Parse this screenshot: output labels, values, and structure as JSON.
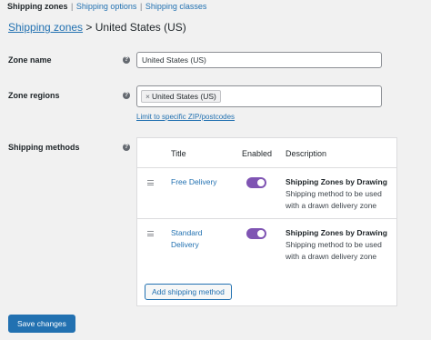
{
  "subnav": {
    "items": [
      {
        "label": "Shipping zones"
      },
      {
        "label": "Shipping options"
      },
      {
        "label": "Shipping classes"
      }
    ],
    "separator": "|"
  },
  "breadcrumb": {
    "link": "Shipping zones",
    "arrow": ">",
    "current": "United States (US)"
  },
  "form": {
    "zone_name": {
      "label": "Zone name",
      "value": "United States (US)"
    },
    "zone_regions": {
      "label": "Zone regions",
      "token_remove": "×",
      "token": "United States (US)",
      "limit_link": "Limit to specific ZIP/postcodes"
    },
    "help_glyph": "?"
  },
  "shipping_methods": {
    "label": "Shipping methods",
    "columns": {
      "title": "Title",
      "enabled": "Enabled",
      "description": "Description"
    },
    "rows": [
      {
        "title": "Free Delivery",
        "enabled": true,
        "desc_title": "Shipping Zones by Drawing",
        "desc_text": "Shipping method to be used with a drawn delivery zone"
      },
      {
        "title": "Standard Delivery",
        "enabled": true,
        "desc_title": "Shipping Zones by Drawing",
        "desc_text": "Shipping method to be used with a drawn delivery zone"
      }
    ],
    "add_button": "Add shipping method"
  },
  "actions": {
    "save_label": "Save changes"
  },
  "colors": {
    "accent": "#2271b1",
    "toggle_on": "#7f54b3"
  }
}
